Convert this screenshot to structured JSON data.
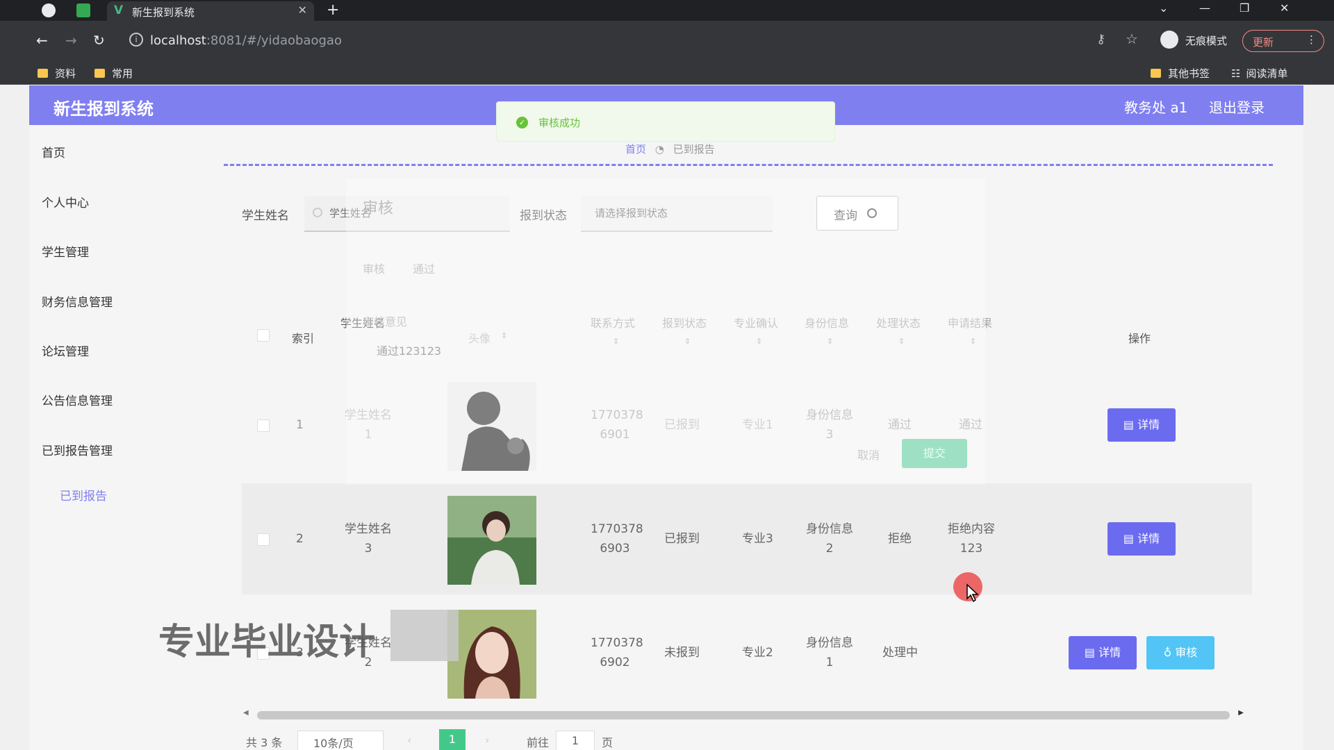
{
  "browser": {
    "tab_title": "新生报到系统",
    "url_host": "localhost",
    "url_rest": ":8081/#/yidaobaogao",
    "incognito_label": "无痕模式",
    "update_label": "更新",
    "bookmarks": [
      "资料",
      "常用"
    ],
    "other_bookmarks": "其他书签",
    "reading_list": "阅读清单"
  },
  "header": {
    "title": "新生报到系统",
    "user": "教务处 a1",
    "logout": "退出登录"
  },
  "sidebar": {
    "items": [
      {
        "label": "首页"
      },
      {
        "label": "个人中心"
      },
      {
        "label": "学生管理"
      },
      {
        "label": "财务信息管理"
      },
      {
        "label": "论坛管理"
      },
      {
        "label": "公告信息管理"
      },
      {
        "label": "已到报告管理"
      }
    ],
    "sub_item": "已到报告"
  },
  "breadcrumb": {
    "home": "首页",
    "current": "已到报告"
  },
  "toast": {
    "message": "审核成功",
    "type": "success"
  },
  "search": {
    "name_label": "学生姓名",
    "name_placeholder": "学生姓名",
    "status_label": "报到状态",
    "status_placeholder": "请选择报到状态",
    "query_label": "查询"
  },
  "table": {
    "headers": {
      "index": "索引",
      "name": "学生姓名",
      "avatar": "头像",
      "contact": "联系方式",
      "status": "报到状态",
      "major": "专业确认",
      "identity": "身份信息",
      "process": "处理状态",
      "result": "申请结果",
      "actions": "操作"
    },
    "rows": [
      {
        "index": "1",
        "name": "学生姓名\n1",
        "contact": "1770378\n6901",
        "status": "已报到",
        "major": "专业1",
        "identity": "身份信息\n3",
        "process": "通过",
        "result": "通过"
      },
      {
        "index": "2",
        "name": "学生姓名\n3",
        "contact": "1770378\n6903",
        "status": "已报到",
        "major": "专业3",
        "identity": "身份信息\n2",
        "process": "拒绝",
        "result": "拒绝内容\n123"
      },
      {
        "index": "3",
        "name": "学生姓名\n2",
        "contact": "1770378\n6902",
        "status": "未报到",
        "major": "专业2",
        "identity": "身份信息\n1",
        "process": "处理中",
        "result": ""
      }
    ],
    "detail_label": "详情",
    "review_label": "审核"
  },
  "modal_ghost": {
    "title": "审核",
    "options": [
      "审核",
      "通过"
    ],
    "opinion_label": "审核意见",
    "opinion_value": "通过123123",
    "cancel": "取消",
    "submit": "提交"
  },
  "pagination": {
    "total": "共 3 条",
    "page_size": "10条/页",
    "current": "1",
    "goto_prefix": "前往",
    "goto_value": "1",
    "goto_suffix": "页"
  },
  "watermark": "专业毕业设计",
  "colors": {
    "primary": "#7f7ff0",
    "success": "#67c23a",
    "review": "#52c4f5"
  }
}
